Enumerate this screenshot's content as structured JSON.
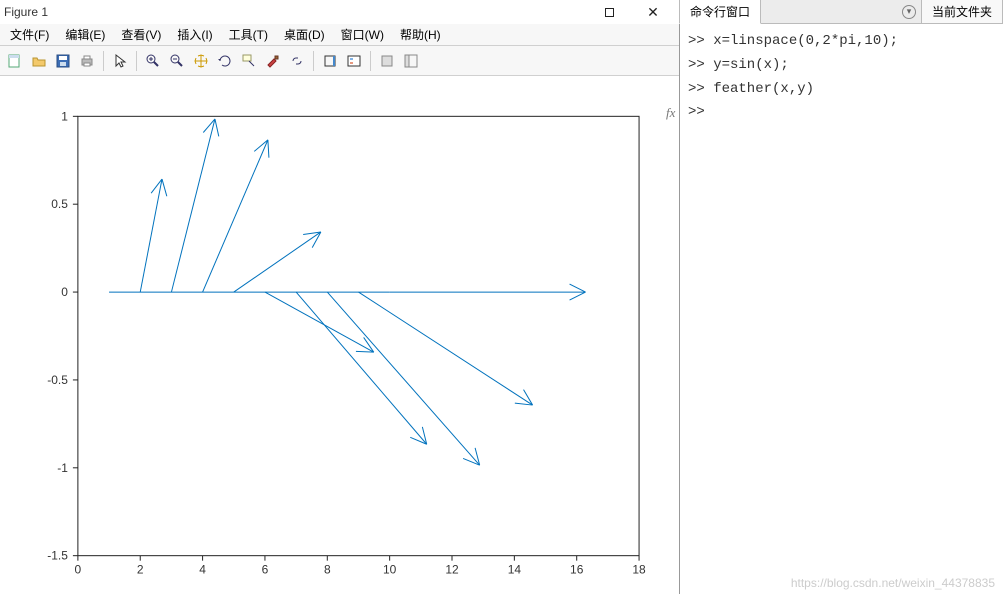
{
  "window": {
    "title": "Figure 1"
  },
  "menus": {
    "file": "文件(F)",
    "edit": "编辑(E)",
    "view": "查看(V)",
    "insert": "插入(I)",
    "tools": "工具(T)",
    "desktop": "桌面(D)",
    "window": "窗口(W)",
    "help": "帮助(H)"
  },
  "side": {
    "tab_cmd": "命令行窗口",
    "tab_file": "当前文件夹"
  },
  "cmd": {
    "l1": ">> x=linspace(0,2*pi,10);",
    "l2": ">> y=sin(x);",
    "l3": ">> feather(x,y)",
    "l4": ">> "
  },
  "watermark": "https://blog.csdn.net/weixin_44378835",
  "chart_data": {
    "type": "feather",
    "title": "",
    "xlabel": "",
    "ylabel": "",
    "xlim": [
      0,
      18
    ],
    "ylim": [
      -1.5,
      1
    ],
    "xticks": [
      0,
      2,
      4,
      6,
      8,
      10,
      12,
      14,
      16,
      18
    ],
    "yticks": [
      -1.5,
      -1,
      -0.5,
      0,
      0.5,
      1
    ],
    "origins_x": [
      1,
      2,
      3,
      4,
      5,
      6,
      7,
      8,
      9,
      10
    ],
    "x": [
      0.0,
      0.698,
      1.396,
      2.094,
      2.793,
      3.491,
      4.189,
      4.887,
      5.585,
      6.283
    ],
    "y": [
      0.0,
      0.643,
      0.985,
      0.866,
      0.342,
      -0.342,
      -0.866,
      -0.985,
      -0.643,
      0.0
    ],
    "vectors": [
      {
        "ox": 1,
        "oy": 0,
        "tx": 1.0,
        "ty": 0.0
      },
      {
        "ox": 2,
        "oy": 0,
        "tx": 2.698,
        "ty": 0.643
      },
      {
        "ox": 3,
        "oy": 0,
        "tx": 4.396,
        "ty": 0.985
      },
      {
        "ox": 4,
        "oy": 0,
        "tx": 6.094,
        "ty": 0.866
      },
      {
        "ox": 5,
        "oy": 0,
        "tx": 7.793,
        "ty": 0.342
      },
      {
        "ox": 6,
        "oy": 0,
        "tx": 9.491,
        "ty": -0.342
      },
      {
        "ox": 7,
        "oy": 0,
        "tx": 11.189,
        "ty": -0.866
      },
      {
        "ox": 8,
        "oy": 0,
        "tx": 12.887,
        "ty": -0.985
      },
      {
        "ox": 9,
        "oy": 0,
        "tx": 14.585,
        "ty": -0.643
      },
      {
        "ox": 10,
        "oy": 0,
        "tx": 16.283,
        "ty": 0.0
      }
    ],
    "baseline": {
      "x0": 1,
      "y0": 0,
      "x1": 10,
      "y1": 0
    }
  }
}
